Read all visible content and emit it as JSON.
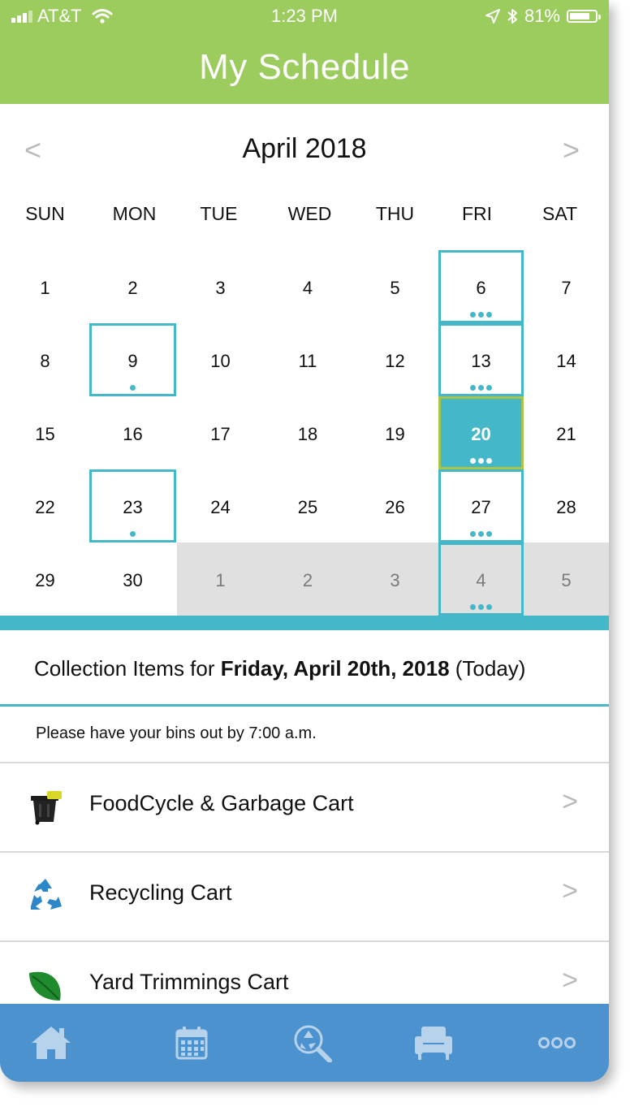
{
  "status_bar": {
    "carrier": "AT&T",
    "time": "1:23 PM",
    "battery": "81%",
    "battery_level": 0.81
  },
  "header": {
    "title": "My Schedule"
  },
  "calendar": {
    "month_label": "April 2018",
    "prev_glyph": "<",
    "next_glyph": ">",
    "weekdays": [
      "SUN",
      "MON",
      "TUE",
      "WED",
      "THU",
      "FRI",
      "SAT"
    ],
    "weeks": [
      [
        {
          "d": "1"
        },
        {
          "d": "2"
        },
        {
          "d": "3"
        },
        {
          "d": "4"
        },
        {
          "d": "5"
        },
        {
          "d": "6",
          "pickup": true,
          "dots": 3
        },
        {
          "d": "7"
        }
      ],
      [
        {
          "d": "8"
        },
        {
          "d": "9",
          "pickup": true,
          "dots": 1
        },
        {
          "d": "10"
        },
        {
          "d": "11"
        },
        {
          "d": "12"
        },
        {
          "d": "13",
          "pickup": true,
          "dots": 3
        },
        {
          "d": "14"
        }
      ],
      [
        {
          "d": "15"
        },
        {
          "d": "16"
        },
        {
          "d": "17"
        },
        {
          "d": "18"
        },
        {
          "d": "19"
        },
        {
          "d": "20",
          "today": true,
          "dots": 3
        },
        {
          "d": "21"
        }
      ],
      [
        {
          "d": "22"
        },
        {
          "d": "23",
          "pickup": true,
          "dots": 1
        },
        {
          "d": "24"
        },
        {
          "d": "25"
        },
        {
          "d": "26"
        },
        {
          "d": "27",
          "pickup": true,
          "dots": 3
        },
        {
          "d": "28"
        }
      ],
      [
        {
          "d": "29"
        },
        {
          "d": "30"
        },
        {
          "d": "1",
          "other": true
        },
        {
          "d": "2",
          "other": true
        },
        {
          "d": "3",
          "other": true
        },
        {
          "d": "4",
          "other": true,
          "pickup": true,
          "dots": 3
        },
        {
          "d": "5",
          "other": true
        }
      ]
    ]
  },
  "collection": {
    "prefix": "Collection Items for ",
    "date": "Friday, April 20th, 2018",
    "suffix": " (Today)",
    "notice": "Please have your bins out by 7:00 a.m."
  },
  "items": [
    {
      "label": "FoodCycle & Garbage Cart",
      "icon": "garbage-cart-icon"
    },
    {
      "label": "Recycling Cart",
      "icon": "recycle-icon"
    },
    {
      "label": "Yard Trimmings Cart",
      "icon": "leaf-icon"
    }
  ],
  "tabs": [
    {
      "icon": "home-icon"
    },
    {
      "icon": "calendar-icon"
    },
    {
      "icon": "recycle-search-icon"
    },
    {
      "icon": "armchair-icon"
    },
    {
      "icon": "more-icon"
    }
  ],
  "colors": {
    "header_green": "#9ccb5e",
    "teal": "#44b8c9",
    "today_border": "#a9c44a",
    "tab_blue": "#4c92cf"
  }
}
